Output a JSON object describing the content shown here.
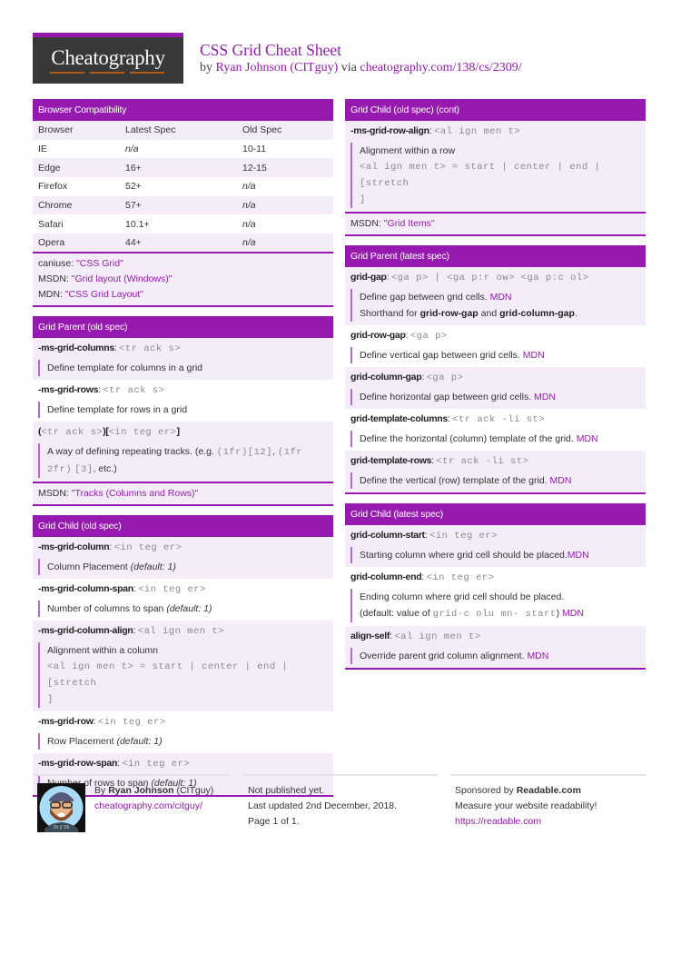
{
  "header": {
    "logo": "Cheatography",
    "title": "CSS Grid Cheat Sheet",
    "by_prefix": "by",
    "author": "Ryan Johnson (CITguy)",
    "via": "via",
    "url": "cheatography.com/138/cs/2309/"
  },
  "browser_compat": {
    "title": "Browser Compatibility",
    "columns": [
      "Browser",
      "Latest Spec",
      "Old Spec"
    ],
    "rows": [
      {
        "browser": "IE",
        "latest": "n/a",
        "old": "10-11"
      },
      {
        "browser": "Edge",
        "latest": "16+",
        "old": "12-15"
      },
      {
        "browser": "Firefox",
        "latest": "52+",
        "old": "n/a"
      },
      {
        "browser": "Chrome",
        "latest": "57+",
        "old": "n/a"
      },
      {
        "browser": "Safari",
        "latest": "10.1+",
        "old": "n/a"
      },
      {
        "browser": "Opera",
        "latest": "44+",
        "old": "n/a"
      }
    ],
    "notes": [
      {
        "label": "caniuse:",
        "link": "\"CSS Grid\""
      },
      {
        "label": "MSDN:",
        "link": "\"Grid layout (Windows)\""
      },
      {
        "label": "MDN:",
        "link": "\"CSS Grid Layout\""
      }
    ]
  },
  "grid_parent_old": {
    "title": "Grid Parent (old spec)",
    "entries": [
      {
        "prop": "-ms-grid-columns",
        "value": "<tr ack s>",
        "desc": "Define template for columns in a grid"
      },
      {
        "prop": "-ms-grid-rows",
        "value": "<tr ack s>",
        "desc": "Define template for rows in a grid"
      }
    ],
    "repeat": {
      "open": "(",
      "tracks": "<tr ack s>",
      "mid": ")[",
      "count": "<in teg er>",
      "close": "]",
      "desc_text": "A way of defining repeating tracks. (e.g.",
      "ex1": "(1fr)[12]",
      "sep": ",",
      "ex2": "(1fr 2fr)",
      "ex3": "[3]",
      "desc_end": ", etc.)"
    },
    "note": {
      "label": "MSDN:",
      "link": "\"Tracks (Columns and Rows)\""
    }
  },
  "grid_child_old": {
    "title": "Grid Child (old spec)",
    "entries": [
      {
        "prop": "-ms-grid-column",
        "value": "<in teg er>",
        "desc": "Column Placement",
        "default": "(default: 1)"
      },
      {
        "prop": "-ms-grid-column-span",
        "value": "<in teg er>",
        "desc": "Number of columns to span",
        "default": "(default: 1)"
      }
    ],
    "align": {
      "prop": "-ms-grid-column-align",
      "value": "<al ign men t>",
      "desc": "Alignment within a column",
      "code1": "<al ign men t> = start | center | end | [stretch",
      "code2": "]"
    },
    "entries2": [
      {
        "prop": "-ms-grid-row",
        "value": "<in teg er>",
        "desc": "Row Placement",
        "default": "(default: 1)"
      },
      {
        "prop": "-ms-grid-row-span",
        "value": "<in teg er>",
        "desc": "Number of rows to span",
        "default": "(default: 1)"
      }
    ]
  },
  "grid_child_old_cont": {
    "title": "Grid Child (old spec) (cont)",
    "align": {
      "prop": "-ms-grid-row-align",
      "value": "<al ign men t>",
      "desc": "Alignment within a row",
      "code1": "<al ign men t> = start | center | end | [stretch",
      "code2": "]"
    },
    "note": {
      "label": "MSDN:",
      "link": "\"Grid Items\""
    }
  },
  "grid_parent_latest": {
    "title": "Grid Parent (latest spec)",
    "gap": {
      "prop": "grid-gap",
      "value": "<ga p> | <ga p:r ow> <ga p:c ol>",
      "desc": "Define gap between grid cells.",
      "link": "MDN",
      "short_prefix": "Shorthand for",
      "short_a": "grid-row-gap",
      "short_and": "and",
      "short_b": "grid-column-gap",
      "short_end": "."
    },
    "entries": [
      {
        "prop": "grid-row-gap",
        "value": "<ga p>",
        "desc": "Define vertical gap between grid cells.",
        "link": "MDN"
      },
      {
        "prop": "grid-column-gap",
        "value": "<ga p>",
        "desc": "Define horizontal gap between grid cells.",
        "link": "MDN"
      },
      {
        "prop": "grid-template-columns",
        "value": "<tr ack -li st>",
        "desc": "Define the horizontal (column) template of the grid.",
        "link": "MDN"
      },
      {
        "prop": "grid-template-rows",
        "value": "<tr ack -li st>",
        "desc": "Define the vertical (row) template of the grid.",
        "link": "MDN"
      }
    ]
  },
  "grid_child_latest": {
    "title": "Grid Child (latest spec)",
    "start": {
      "prop": "grid-column-start",
      "value": "<in teg er>",
      "desc": "Starting column where grid cell should be placed.",
      "link": "MDN"
    },
    "end": {
      "prop": "grid-column-end",
      "value": "<in teg er>",
      "desc": "Ending column where grid cell should be placed.",
      "desc2_prefix": "(default: value of",
      "desc2_code": "grid-c olu mn- start",
      "desc2_end": ")",
      "link": "MDN"
    },
    "self": {
      "prop": "align-self",
      "value": "<al ign men t>",
      "desc": "Override parent grid column alignment.",
      "link": "MDN"
    }
  },
  "footer": {
    "by": "By",
    "author_name": "Ryan Johnson",
    "author_handle": "(CITguy)",
    "author_url": "cheatography.com/citguy/",
    "avatar_caption": "2b || !2b",
    "published": "Not published yet.",
    "updated": "Last updated 2nd December, 2018.",
    "page": "Page 1 of 1.",
    "sponsor_prefix": "Sponsored by",
    "sponsor": "Readable.com",
    "sponsor_tagline": "Measure your website readability!",
    "sponsor_url": "https://readable.com"
  }
}
